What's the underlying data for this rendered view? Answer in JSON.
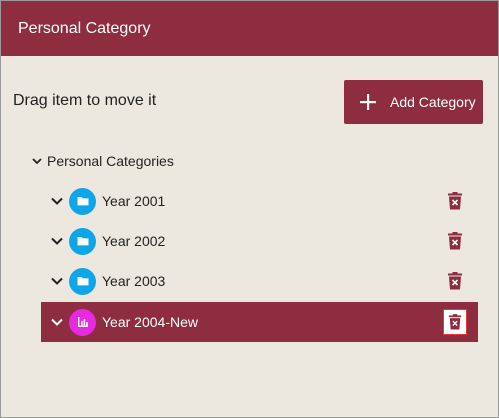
{
  "window": {
    "title": "Personal Category"
  },
  "toolbar": {
    "hint": "Drag item to move it",
    "add_label": "Add Category",
    "add_icon": "plus-icon"
  },
  "tree": {
    "root_label": "Personal Categories",
    "items": [
      {
        "label": "Year 2001",
        "icon": "folder-icon",
        "icon_bg": "#0ea5e9",
        "selected": false
      },
      {
        "label": "Year 2002",
        "icon": "folder-icon",
        "icon_bg": "#0ea5e9",
        "selected": false
      },
      {
        "label": "Year 2003",
        "icon": "folder-icon",
        "icon_bg": "#0ea5e9",
        "selected": false
      },
      {
        "label": "Year 2004-New",
        "icon": "bar-chart-icon",
        "icon_bg": "#e62ae0",
        "selected": true
      }
    ]
  },
  "colors": {
    "accent": "#8e2c40",
    "background": "#ece8df",
    "folder_circle": "#0ea5e9",
    "chart_circle": "#e62ae0",
    "delete_icon": "#8e2c40",
    "focus_outline": "#e03a3a"
  }
}
